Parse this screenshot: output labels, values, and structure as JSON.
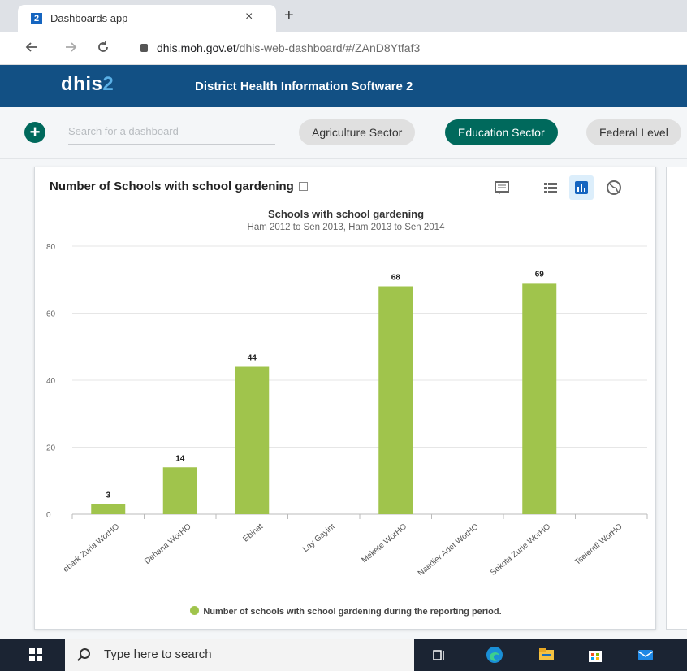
{
  "browser": {
    "tab_favicon": "2",
    "tab_title": "Dashboards app",
    "tab_close": "×",
    "new_tab": "+",
    "url_host": "dhis.moh.gov.et",
    "url_path": "/dhis-web-dashboard/#/ZAnD8Ytfaf3",
    "nav_icons": [
      "back-arrow-icon",
      "forward-arrow-icon",
      "reload-icon",
      "lock-icon"
    ]
  },
  "header": {
    "logo_main": "dhis",
    "logo_suffix": "2",
    "title": "District Health Information Software 2"
  },
  "dashboard_bar": {
    "add_label": "+",
    "search_placeholder": "Search for a dashboard",
    "chips": [
      {
        "label": "Agriculture Sector",
        "active": false
      },
      {
        "label": "Education Sector",
        "active": true
      },
      {
        "label": "Federal Level",
        "active": false
      }
    ]
  },
  "card": {
    "title": "Number of Schools with school gardening",
    "icons": [
      "interpretations-icon",
      "table-view-icon",
      "chart-view-icon",
      "map-view-icon"
    ],
    "active_icon": "chart-view-icon"
  },
  "chart_data": {
    "type": "bar",
    "title": "Schools with school gardening",
    "subtitle": "Ham 2012 to Sen 2013, Ham 2013 to Sen 2014",
    "categories": [
      "Debark Zuria WorHO",
      "Dehana WorHO",
      "Ebinat",
      "Lay Gayint",
      "Mekete WorHO",
      "Naedier Adet WorHO",
      "Sekota Zurie WorHO",
      "Tselemti WorHO"
    ],
    "visible_category_labels": [
      "ebark Zuria WorHO",
      "Dehana WorHO",
      "Ebinat",
      "Lay Gayint",
      "Mekete WorHO",
      "Naedier Adet WorHO",
      "Sekota Zurie WorHO",
      "Tselemti WorHO"
    ],
    "series": [
      {
        "name": "Number of schools with school gardening during the reporting period.",
        "values": [
          3,
          14,
          44,
          null,
          68,
          null,
          69,
          null
        ],
        "color": "#a0c44c"
      }
    ],
    "ylim": [
      0,
      80
    ],
    "yticks": [
      0,
      20,
      40,
      60,
      80
    ],
    "grid": true,
    "legend_position": "bottom"
  },
  "taskbar": {
    "search_text": "Type here to search",
    "icons": [
      "windows-start-icon",
      "task-view-icon",
      "edge-icon",
      "file-explorer-icon",
      "store-icon",
      "mail-icon"
    ]
  }
}
